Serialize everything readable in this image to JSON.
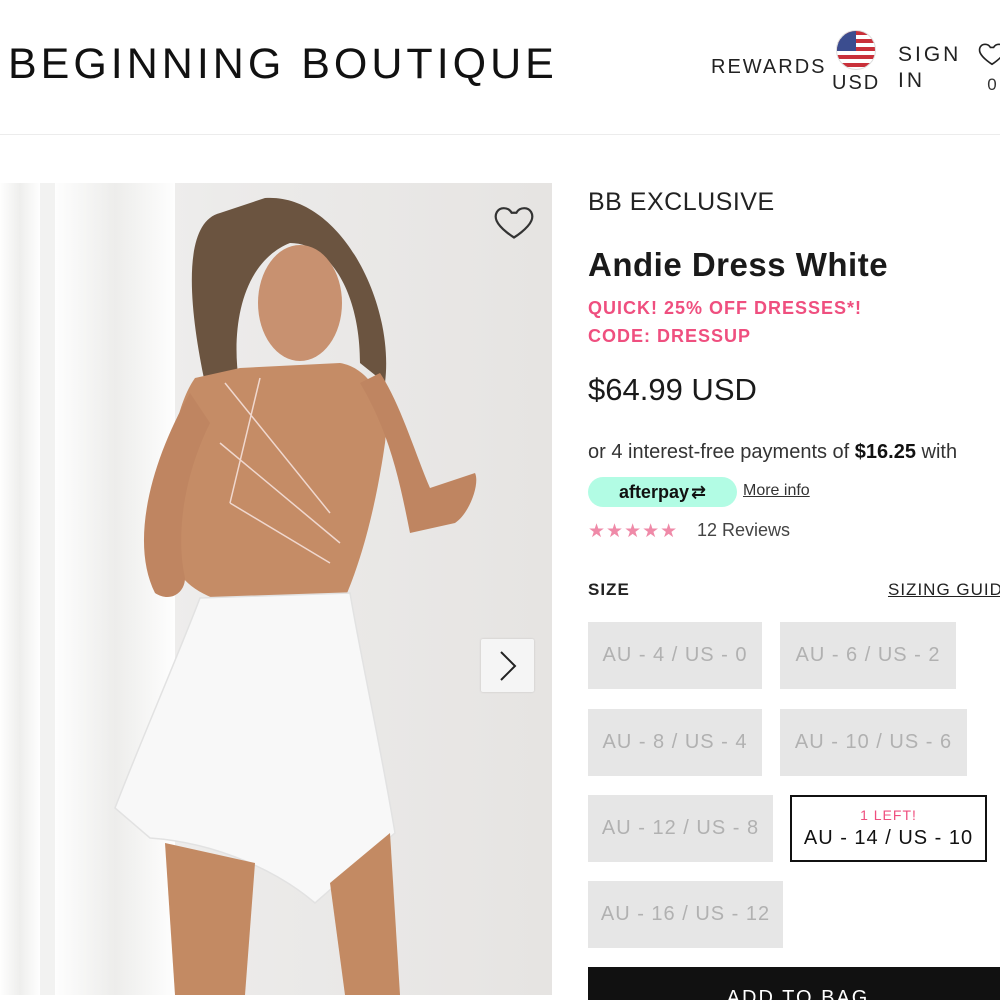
{
  "header": {
    "logo": "BEGINNING BOUTIQUE",
    "rewards": "REWARDS",
    "currency": "USD",
    "sign_in": "SIGN IN",
    "wishlist_count": "0"
  },
  "product": {
    "vendor": "BB EXCLUSIVE",
    "title": "Andie Dress White",
    "promo_line1": "QUICK! 25% OFF DRESSES*!",
    "promo_line2": "CODE: DRESSUP",
    "price": "$64.99 USD",
    "afterpay_prefix": "or 4 interest-free payments of ",
    "afterpay_amount": "$16.25",
    "afterpay_suffix": " with",
    "afterpay_logo": "afterpay",
    "more_info": "More info",
    "rating_stars": "★★★★★",
    "rating": 4.5,
    "reviews": "12 Reviews"
  },
  "sizes": {
    "label": "SIZE",
    "guide": "SIZING GUIDE",
    "options": [
      {
        "label": "AU - 4 / US - 0",
        "available": false
      },
      {
        "label": "AU - 6 / US - 2",
        "available": false
      },
      {
        "label": "AU - 8 / US - 4",
        "available": false
      },
      {
        "label": "AU - 10 / US - 6",
        "available": false
      },
      {
        "label": "AU - 12 / US - 8",
        "available": false
      },
      {
        "label": "AU - 14 / US - 10",
        "available": true,
        "note": "1 LEFT!"
      },
      {
        "label": "AU - 16 / US - 12",
        "available": false
      }
    ]
  },
  "cart": {
    "add_to_bag": "ADD TO BAG"
  },
  "colors": {
    "accent_pink": "#ef4f7f",
    "afterpay_mint": "#b2fce4",
    "star_pink": "#ef8aa8"
  }
}
